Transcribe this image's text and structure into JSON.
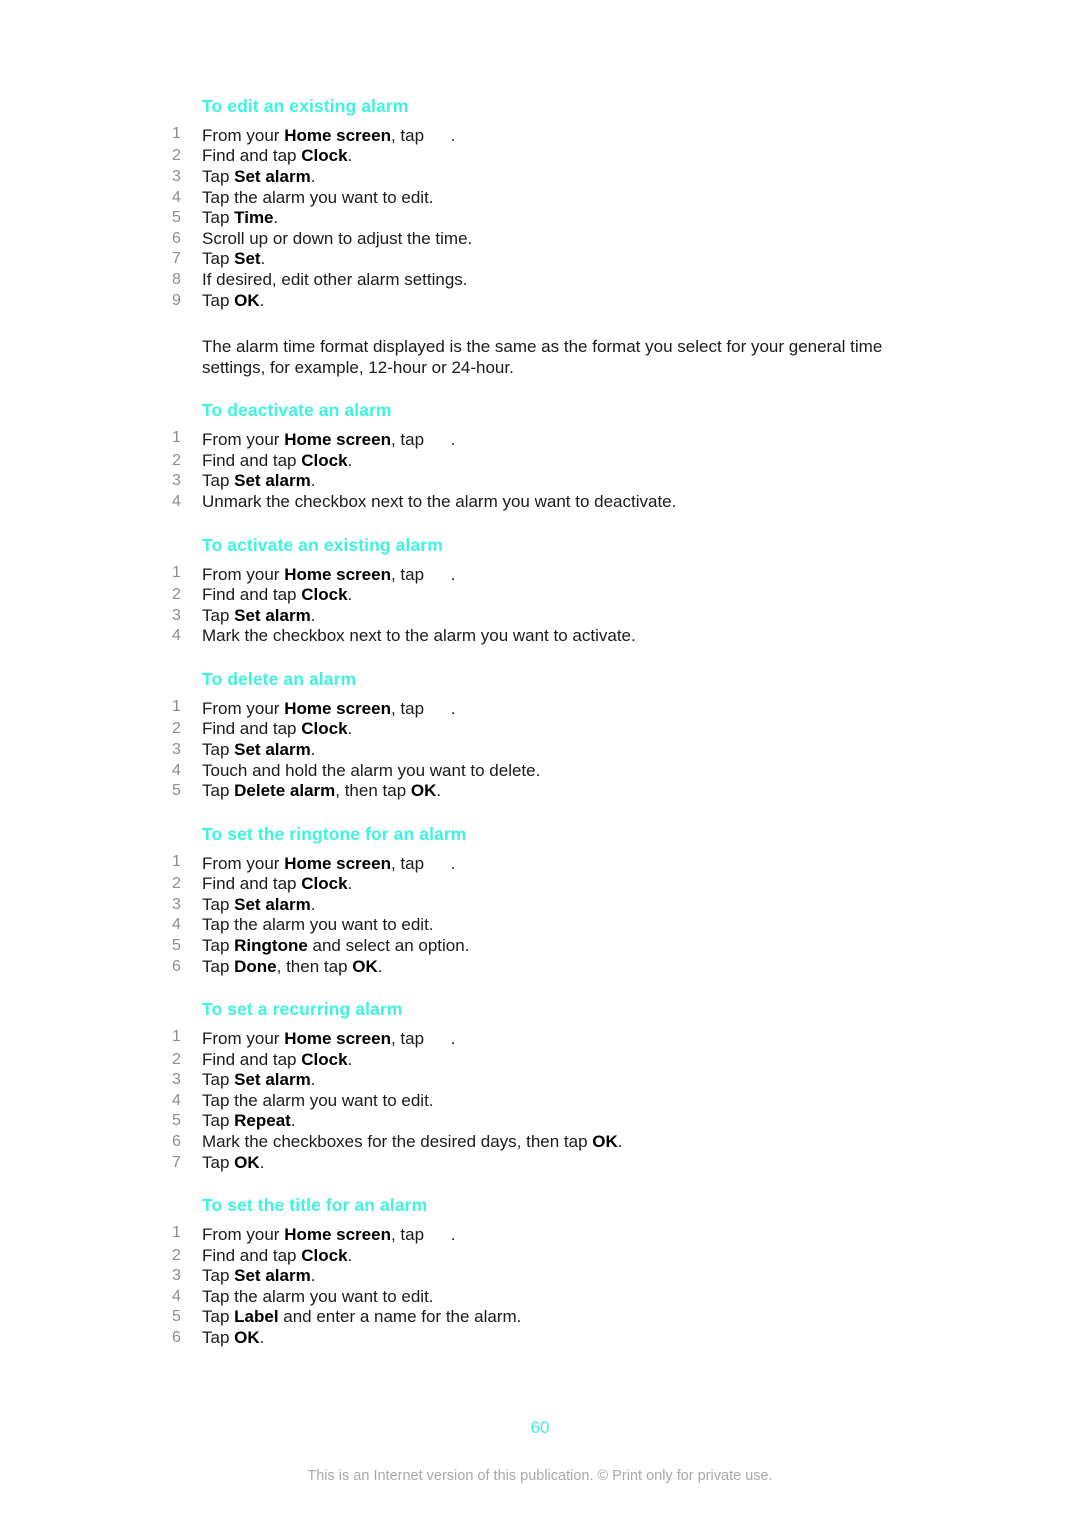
{
  "document": {
    "background_color": "#ffffff",
    "heading_color": "#3ff3e0",
    "body_color": "#1b1b1b",
    "number_color": "#8d8d8d",
    "footer_color": "#a9a9a9"
  },
  "sections": [
    {
      "heading": "To edit an existing alarm",
      "steps": [
        {
          "num": "1",
          "parts": [
            {
              "t": "From your "
            },
            {
              "b": "Home screen"
            },
            {
              "t": ", tap "
            },
            {
              "icon": "home-screen-icon"
            },
            {
              "t": "."
            }
          ]
        },
        {
          "num": "2",
          "parts": [
            {
              "t": "Find and tap "
            },
            {
              "b": "Clock"
            },
            {
              "t": "."
            }
          ]
        },
        {
          "num": "3",
          "parts": [
            {
              "t": "Tap "
            },
            {
              "b": "Set alarm"
            },
            {
              "t": "."
            }
          ]
        },
        {
          "num": "4",
          "parts": [
            {
              "t": "Tap the alarm you want to edit."
            }
          ]
        },
        {
          "num": "5",
          "parts": [
            {
              "t": "Tap "
            },
            {
              "b": "Time"
            },
            {
              "t": "."
            }
          ]
        },
        {
          "num": "6",
          "parts": [
            {
              "t": "Scroll up or down to adjust the time."
            }
          ]
        },
        {
          "num": "7",
          "parts": [
            {
              "t": "Tap "
            },
            {
              "b": "Set"
            },
            {
              "t": "."
            }
          ]
        },
        {
          "num": "8",
          "parts": [
            {
              "t": "If desired, edit other alarm settings."
            }
          ]
        },
        {
          "num": "9",
          "parts": [
            {
              "t": "Tap "
            },
            {
              "b": "OK"
            },
            {
              "t": "."
            }
          ]
        }
      ],
      "note": "The alarm time format displayed is the same as the format you select for your general time settings, for example, 12-hour or 24-hour."
    },
    {
      "heading": "To deactivate an alarm",
      "steps": [
        {
          "num": "1",
          "parts": [
            {
              "t": "From your "
            },
            {
              "b": "Home screen"
            },
            {
              "t": ", tap "
            },
            {
              "icon": "home-screen-icon"
            },
            {
              "t": "."
            }
          ]
        },
        {
          "num": "2",
          "parts": [
            {
              "t": "Find and tap "
            },
            {
              "b": "Clock"
            },
            {
              "t": "."
            }
          ]
        },
        {
          "num": "3",
          "parts": [
            {
              "t": "Tap "
            },
            {
              "b": "Set alarm"
            },
            {
              "t": "."
            }
          ]
        },
        {
          "num": "4",
          "parts": [
            {
              "t": "Unmark the checkbox next to the alarm you want to deactivate."
            }
          ]
        }
      ],
      "note": null
    },
    {
      "heading": "To activate an existing alarm",
      "steps": [
        {
          "num": "1",
          "parts": [
            {
              "t": "From your "
            },
            {
              "b": "Home screen"
            },
            {
              "t": ", tap "
            },
            {
              "icon": "home-screen-icon"
            },
            {
              "t": "."
            }
          ]
        },
        {
          "num": "2",
          "parts": [
            {
              "t": "Find and tap "
            },
            {
              "b": "Clock"
            },
            {
              "t": "."
            }
          ]
        },
        {
          "num": "3",
          "parts": [
            {
              "t": "Tap "
            },
            {
              "b": "Set alarm"
            },
            {
              "t": "."
            }
          ]
        },
        {
          "num": "4",
          "parts": [
            {
              "t": "Mark the checkbox next to the alarm you want to activate."
            }
          ]
        }
      ],
      "note": null
    },
    {
      "heading": "To delete an alarm",
      "steps": [
        {
          "num": "1",
          "parts": [
            {
              "t": "From your "
            },
            {
              "b": "Home screen"
            },
            {
              "t": ", tap "
            },
            {
              "icon": "home-screen-icon"
            },
            {
              "t": "."
            }
          ]
        },
        {
          "num": "2",
          "parts": [
            {
              "t": "Find and tap "
            },
            {
              "b": "Clock"
            },
            {
              "t": "."
            }
          ]
        },
        {
          "num": "3",
          "parts": [
            {
              "t": "Tap "
            },
            {
              "b": "Set alarm"
            },
            {
              "t": "."
            }
          ]
        },
        {
          "num": "4",
          "parts": [
            {
              "t": "Touch and hold the alarm you want to delete."
            }
          ]
        },
        {
          "num": "5",
          "parts": [
            {
              "t": "Tap "
            },
            {
              "b": "Delete alarm"
            },
            {
              "t": ", then tap "
            },
            {
              "b": "OK"
            },
            {
              "t": "."
            }
          ]
        }
      ],
      "note": null
    },
    {
      "heading": "To set the ringtone for an alarm",
      "steps": [
        {
          "num": "1",
          "parts": [
            {
              "t": "From your "
            },
            {
              "b": "Home screen"
            },
            {
              "t": ", tap "
            },
            {
              "icon": "home-screen-icon"
            },
            {
              "t": "."
            }
          ]
        },
        {
          "num": "2",
          "parts": [
            {
              "t": "Find and tap "
            },
            {
              "b": "Clock"
            },
            {
              "t": "."
            }
          ]
        },
        {
          "num": "3",
          "parts": [
            {
              "t": "Tap "
            },
            {
              "b": "Set alarm"
            },
            {
              "t": "."
            }
          ]
        },
        {
          "num": "4",
          "parts": [
            {
              "t": "Tap the alarm you want to edit."
            }
          ]
        },
        {
          "num": "5",
          "parts": [
            {
              "t": "Tap "
            },
            {
              "b": "Ringtone"
            },
            {
              "t": " and select an option."
            }
          ]
        },
        {
          "num": "6",
          "parts": [
            {
              "t": "Tap "
            },
            {
              "b": "Done"
            },
            {
              "t": ", then tap "
            },
            {
              "b": "OK"
            },
            {
              "t": "."
            }
          ]
        }
      ],
      "note": null
    },
    {
      "heading": "To set a recurring alarm",
      "steps": [
        {
          "num": "1",
          "parts": [
            {
              "t": "From your "
            },
            {
              "b": "Home screen"
            },
            {
              "t": ", tap "
            },
            {
              "icon": "home-screen-icon"
            },
            {
              "t": "."
            }
          ]
        },
        {
          "num": "2",
          "parts": [
            {
              "t": "Find and tap "
            },
            {
              "b": "Clock"
            },
            {
              "t": "."
            }
          ]
        },
        {
          "num": "3",
          "parts": [
            {
              "t": "Tap "
            },
            {
              "b": "Set alarm"
            },
            {
              "t": "."
            }
          ]
        },
        {
          "num": "4",
          "parts": [
            {
              "t": "Tap the alarm you want to edit."
            }
          ]
        },
        {
          "num": "5",
          "parts": [
            {
              "t": "Tap "
            },
            {
              "b": "Repeat"
            },
            {
              "t": "."
            }
          ]
        },
        {
          "num": "6",
          "parts": [
            {
              "t": "Mark the checkboxes for the desired days, then tap "
            },
            {
              "b": "OK"
            },
            {
              "t": "."
            }
          ]
        },
        {
          "num": "7",
          "parts": [
            {
              "t": "Tap "
            },
            {
              "b": "OK"
            },
            {
              "t": "."
            }
          ]
        }
      ],
      "note": null
    },
    {
      "heading": "To set the title for an alarm",
      "steps": [
        {
          "num": "1",
          "parts": [
            {
              "t": "From your "
            },
            {
              "b": "Home screen"
            },
            {
              "t": ", tap "
            },
            {
              "icon": "home-screen-icon"
            },
            {
              "t": "."
            }
          ]
        },
        {
          "num": "2",
          "parts": [
            {
              "t": "Find and tap "
            },
            {
              "b": "Clock"
            },
            {
              "t": "."
            }
          ]
        },
        {
          "num": "3",
          "parts": [
            {
              "t": "Tap "
            },
            {
              "b": "Set alarm"
            },
            {
              "t": "."
            }
          ]
        },
        {
          "num": "4",
          "parts": [
            {
              "t": "Tap the alarm you want to edit."
            }
          ]
        },
        {
          "num": "5",
          "parts": [
            {
              "t": "Tap "
            },
            {
              "b": "Label"
            },
            {
              "t": " and enter a name for the alarm."
            }
          ]
        },
        {
          "num": "6",
          "parts": [
            {
              "t": "Tap "
            },
            {
              "b": "OK"
            },
            {
              "t": "."
            }
          ]
        }
      ],
      "note": null
    }
  ],
  "footer": {
    "page_number": "60",
    "notice": "This is an Internet version of this publication. © Print only for private use."
  }
}
